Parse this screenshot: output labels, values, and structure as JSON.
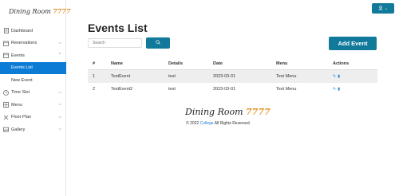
{
  "brand": {
    "name": "Dining Room",
    "accent": "7777"
  },
  "sidebar": {
    "items": [
      {
        "label": "Dashboard",
        "icon": "document-icon"
      },
      {
        "label": "Reservations",
        "icon": "calendar-icon"
      },
      {
        "label": "Events",
        "icon": "calendar-icon"
      },
      {
        "label": "Events List"
      },
      {
        "label": "New Event"
      },
      {
        "label": "Time Slot",
        "icon": "clock-icon"
      },
      {
        "label": "Menu",
        "icon": "grid-icon"
      },
      {
        "label": "Floor Plan",
        "icon": "tools-icon"
      },
      {
        "label": "Gallery",
        "icon": "image-icon"
      }
    ]
  },
  "topbar": {
    "user_icon": "user-icon",
    "chevron": "chevron-down-icon"
  },
  "main": {
    "title": "Events List",
    "search_placeholder": "Search",
    "add_label": "Add Event"
  },
  "table": {
    "headers": [
      "#",
      "Name",
      "Details",
      "Date",
      "Menu",
      "Actions"
    ],
    "rows": [
      {
        "num": "1",
        "name": "TestEvent",
        "details": "test",
        "date": "2023-03-01",
        "menu": "Test Menu"
      },
      {
        "num": "2",
        "name": "TestEvent2",
        "details": "test",
        "date": "2023-03-01",
        "menu": "Test Menu"
      }
    ]
  },
  "footer": {
    "brand_name": "Dining Room",
    "brand_accent": "7777",
    "copy_prefix": "© 2022",
    "copy_link": "College",
    "copy_suffix": "All Rights Reserved."
  },
  "colors": {
    "primary": "#117a9b",
    "active": "#0b7bd6",
    "accent": "#e2932a"
  }
}
